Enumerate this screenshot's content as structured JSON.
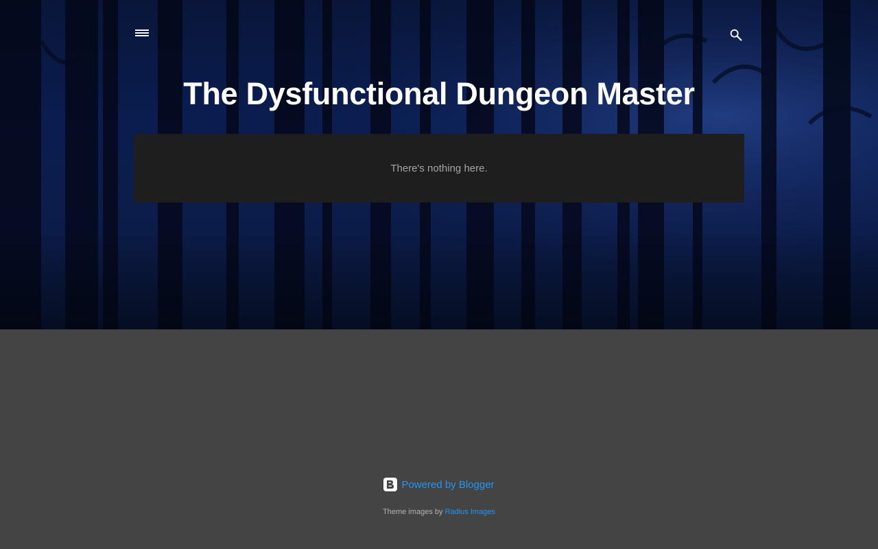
{
  "header": {
    "title": "The Dysfunctional Dungeon Master",
    "menu_icon": "menu-icon",
    "search_icon": "search-icon"
  },
  "main": {
    "empty_message": "There's nothing here."
  },
  "footer": {
    "powered_by_label": "Powered by Blogger",
    "blogger_icon": "blogger-logo-icon",
    "theme_credit_prefix": "Theme images by",
    "theme_credit_link": "Radius Images"
  },
  "colors": {
    "page_background": "#444444",
    "card_background": "#1e1e1e",
    "link": "#2196f3",
    "title": "#ffffff",
    "hero_blue": "#0a1f55"
  }
}
